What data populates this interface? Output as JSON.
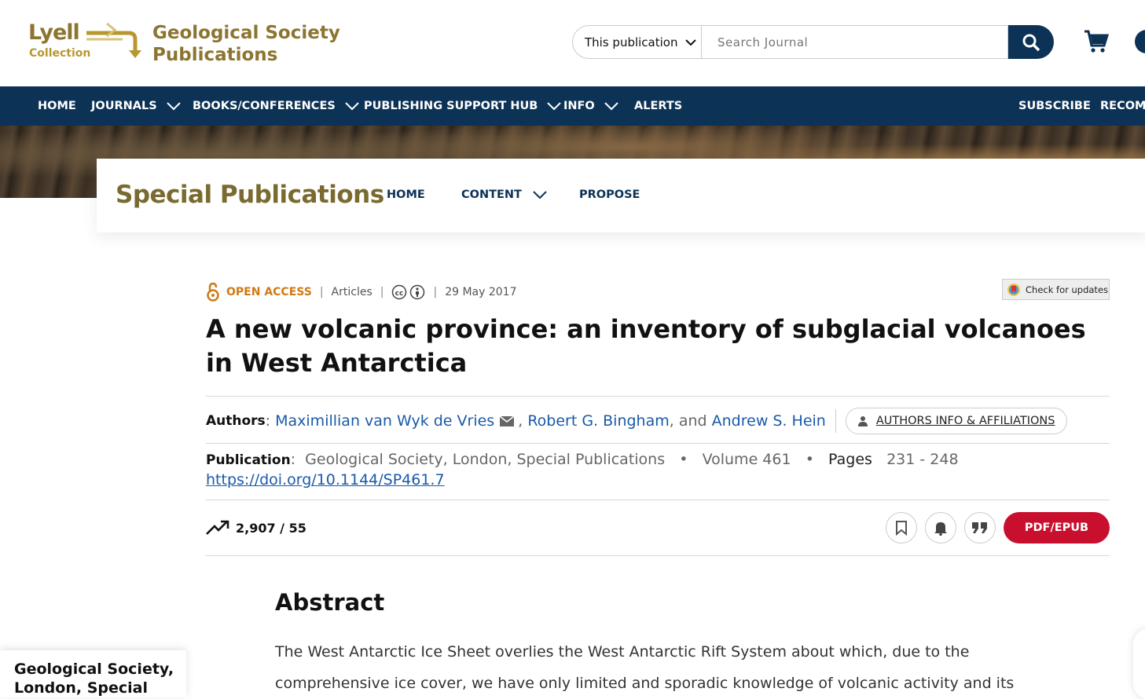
{
  "header": {
    "logo_lyell": "Lyell",
    "logo_collection": "Collection",
    "logo_gsp_line1": "Geological Society",
    "logo_gsp_line2": "Publications",
    "search_scope": "This publication",
    "search_placeholder": "Search Journal"
  },
  "mainnav": {
    "home": "HOME",
    "journals": "JOURNALS",
    "books": "BOOKS/CONFERENCES",
    "hub": "PUBLISHING SUPPORT HUB",
    "info": "INFO",
    "alerts": "ALERTS",
    "subscribe": "SUBSCRIBE",
    "recommend": "RECOMM"
  },
  "journal": {
    "title": "Special Publications",
    "nav_home": "HOME",
    "nav_content": "CONTENT",
    "nav_propose": "PROPOSE"
  },
  "article": {
    "access": "OPEN ACCESS",
    "type": "Articles",
    "date": "29 May 2017",
    "check_updates": "Check for updates",
    "title": "A new volcanic province: an inventory of subglacial volcanoes in West Antarctica",
    "authors_label": "Authors",
    "author1": "Maximillian van Wyk de Vries",
    "author2": "Robert G. Bingham",
    "and": "and",
    "author3": "Andrew S. Hein",
    "affiliations": "AUTHORS INFO & AFFILIATIONS",
    "publication_label": "Publication",
    "publication": "Geological Society, London, Special Publications",
    "volume": "Volume 461",
    "pages_label": "Pages",
    "pages": "231 - 248",
    "doi": "https://doi.org/10.1144/SP461.7",
    "metrics": "2,907 / 55",
    "pdf": "PDF/EPUB",
    "abstract_heading": "Abstract",
    "abstract_text": "The West Antarctic Ice Sheet overlies the West Antarctic Rift System about which, due to the comprehensive ice cover, we have only limited and sporadic knowledge of volcanic activity and its"
  },
  "side_card": "Geological Society, London, Special",
  "colors": {
    "navy": "#0c3256",
    "gold": "#8b7530",
    "link": "#1a5aa8",
    "pdf_red": "#c8102e",
    "oa_orange": "#d07a16"
  }
}
